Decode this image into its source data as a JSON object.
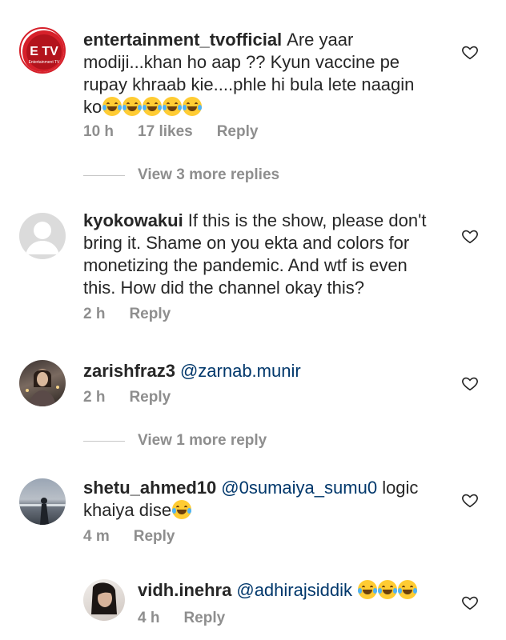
{
  "comments": [
    {
      "username": "entertainment_tvofficial",
      "text": "Are yaar modiji...khan ho aap ?? Kyun vaccine pe rupay khraab kie....phle hi bula lete naagin ko",
      "time": "10 h",
      "likes": "17 likes",
      "reply_label": "Reply",
      "view_more": "View 3 more replies",
      "avatar_text": "E TV",
      "avatar_sub": "Entertainment TV"
    },
    {
      "username": "kyokowakui",
      "text": "If this is the show, please don't bring it. Shame on you ekta and colors for monetizing the pandemic. And wtf is even this. How did the channel okay this?",
      "time": "2 h",
      "reply_label": "Reply"
    },
    {
      "username": "zarishfraz3",
      "mention": "@zarnab.munir",
      "time": "2 h",
      "reply_label": "Reply",
      "view_more": "View 1 more reply"
    },
    {
      "username": "shetu_ahmed10",
      "mention": "@0sumaiya_sumu0",
      "text_after": "logic",
      "text_line2": "khaiya dise",
      "time": "4 m",
      "reply_label": "Reply"
    },
    {
      "username": "vidh.inehra",
      "mention": "@adhirajsiddik",
      "time": "4 h",
      "reply_label": "Reply"
    }
  ],
  "colors": {
    "text": "#262626",
    "meta": "#8e8e8e",
    "mention": "#00376b",
    "etv_red": "#d6202a"
  },
  "icons": [
    "heart-icon",
    "face-with-tears-of-joy-emoji"
  ]
}
